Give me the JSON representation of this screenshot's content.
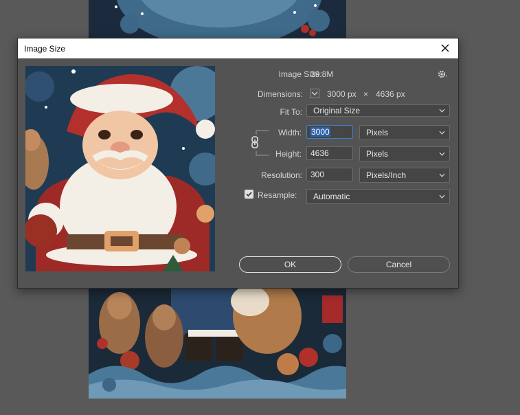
{
  "dialog": {
    "title": "Image Size",
    "image_size_label": "Image Size:",
    "image_size_value": "39.8M",
    "dimensions_label": "Dimensions:",
    "dim_width": "3000 px",
    "dim_times": "×",
    "dim_height": "4636 px",
    "fit_to_label": "Fit To:",
    "fit_to_value": "Original Size",
    "width_label": "Width:",
    "width_value": "3000",
    "width_unit": "Pixels",
    "height_label": "Height:",
    "height_value": "4636",
    "height_unit": "Pixels",
    "resolution_label": "Resolution:",
    "resolution_value": "300",
    "resolution_unit": "Pixels/Inch",
    "resample_label": "Resample:",
    "resample_checked": true,
    "resample_value": "Automatic",
    "ok_label": "OK",
    "cancel_label": "Cancel"
  },
  "colors": {
    "workspace": "#595959",
    "dialog_bg": "#535353",
    "field_bg": "#454545",
    "focus_blue": "#3b7fd0"
  },
  "icons": {
    "close": "close-icon",
    "settings": "gear-icon",
    "constrain": "chain-link-icon",
    "dimensions_menu": "chevron-down-icon"
  }
}
